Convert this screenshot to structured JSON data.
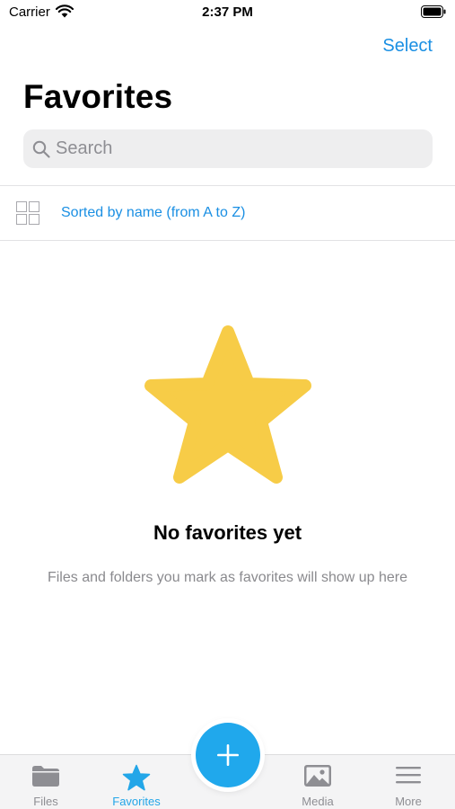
{
  "status_bar": {
    "carrier": "Carrier",
    "time": "2:37 PM"
  },
  "nav": {
    "select_label": "Select",
    "title": "Favorites"
  },
  "search": {
    "placeholder": "Search"
  },
  "sort": {
    "label": "Sorted by name (from A to Z)"
  },
  "empty_state": {
    "title": "No favorites yet",
    "description": "Files and folders you mark as favorites will show up here",
    "icon": "star-icon",
    "icon_color": "#f7cc47"
  },
  "tab_bar": {
    "tabs": [
      {
        "label": "Files",
        "icon": "folder-icon",
        "active": false
      },
      {
        "label": "Favorites",
        "icon": "star-icon",
        "active": true
      },
      {
        "label": "Media",
        "icon": "image-icon",
        "active": false
      },
      {
        "label": "More",
        "icon": "menu-icon",
        "active": false
      }
    ],
    "fab_icon": "plus-icon"
  },
  "colors": {
    "accent": "#1a8fe3",
    "tab_active": "#23a6e8",
    "fab": "#20a8ec"
  }
}
